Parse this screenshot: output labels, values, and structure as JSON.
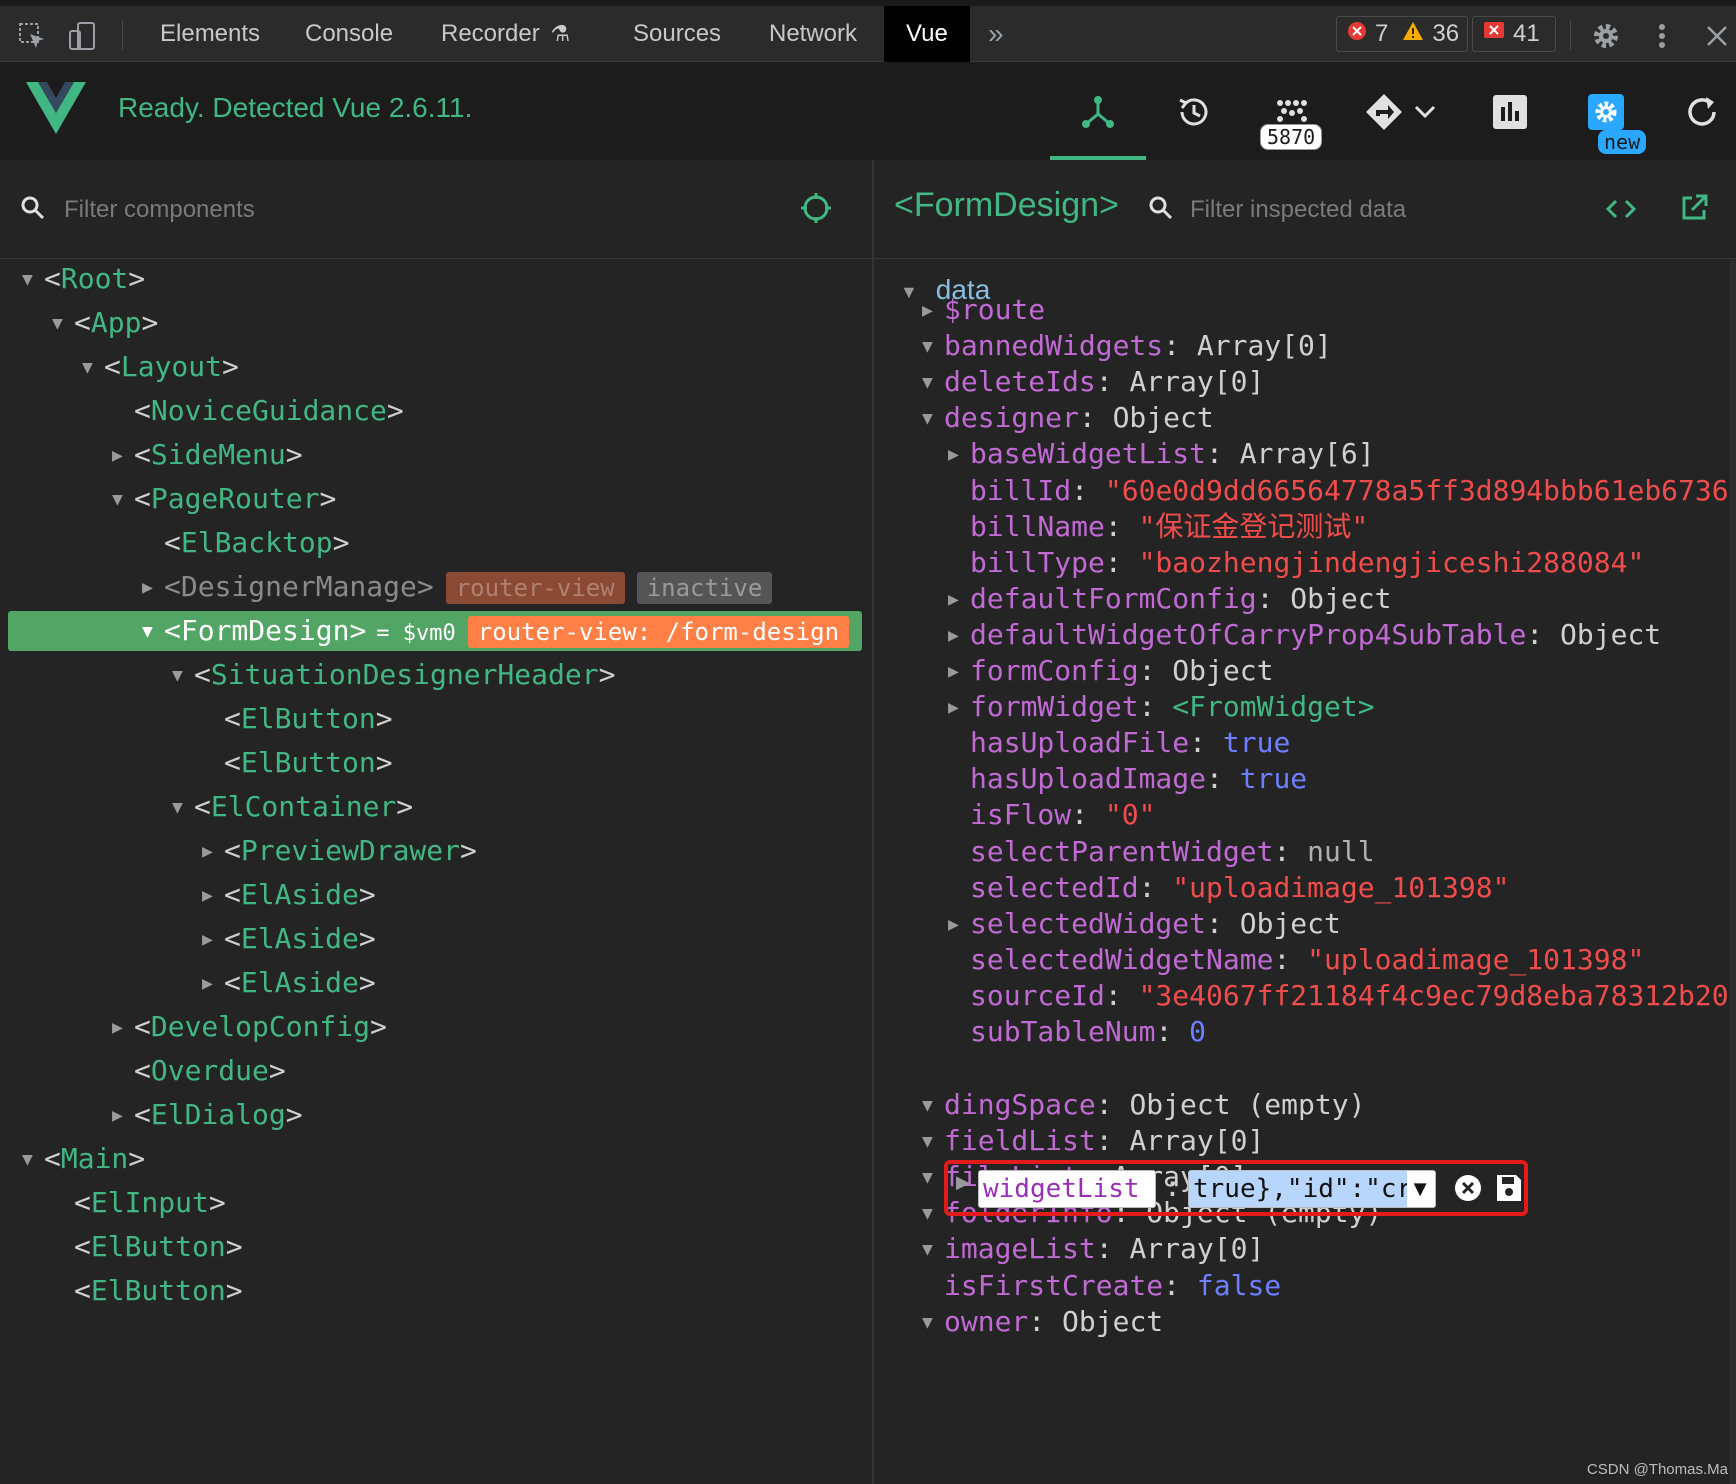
{
  "devtools": {
    "tabs": [
      "Elements",
      "Console",
      "Recorder",
      "Sources",
      "Network",
      "Vue"
    ],
    "active_tab": "Vue",
    "more": "»",
    "errors": "7",
    "warnings": "36",
    "issues": "41"
  },
  "vue": {
    "status": "Ready. Detected Vue 2.6.11.",
    "performance_count": "5870",
    "settings_badge": "new"
  },
  "components": {
    "filter_placeholder": "Filter components",
    "tree": [
      {
        "indent": 0,
        "arrow": "down",
        "name": "Root"
      },
      {
        "indent": 1,
        "arrow": "down",
        "name": "App"
      },
      {
        "indent": 2,
        "arrow": "down",
        "name": "Layout"
      },
      {
        "indent": 3,
        "arrow": "none",
        "name": "NoviceGuidance"
      },
      {
        "indent": 3,
        "arrow": "right",
        "name": "SideMenu"
      },
      {
        "indent": 3,
        "arrow": "down",
        "name": "PageRouter"
      },
      {
        "indent": 4,
        "arrow": "none",
        "name": "ElBacktop"
      },
      {
        "indent": 4,
        "arrow": "right",
        "name": "DesignerManage",
        "inactive": true,
        "badges": [
          "router-view",
          "inactive"
        ]
      },
      {
        "indent": 4,
        "arrow": "down",
        "name": "FormDesign",
        "selected": true,
        "suffix": "= $vm0",
        "badges": [
          "router-view: /form-design"
        ]
      },
      {
        "indent": 5,
        "arrow": "down",
        "name": "SituationDesignerHeader"
      },
      {
        "indent": 6,
        "arrow": "none",
        "name": "ElButton"
      },
      {
        "indent": 6,
        "arrow": "none",
        "name": "ElButton"
      },
      {
        "indent": 5,
        "arrow": "down",
        "name": "ElContainer"
      },
      {
        "indent": 6,
        "arrow": "right",
        "name": "PreviewDrawer"
      },
      {
        "indent": 6,
        "arrow": "right",
        "name": "ElAside"
      },
      {
        "indent": 6,
        "arrow": "right",
        "name": "ElAside"
      },
      {
        "indent": 6,
        "arrow": "right",
        "name": "ElAside"
      },
      {
        "indent": 3,
        "arrow": "right",
        "name": "DevelopConfig"
      },
      {
        "indent": 3,
        "arrow": "none",
        "name": "Overdue"
      },
      {
        "indent": 3,
        "arrow": "right",
        "name": "ElDialog"
      },
      {
        "indent": 0,
        "arrow": "down",
        "name": "Main"
      },
      {
        "indent": 1,
        "arrow": "none",
        "name": "ElInput"
      },
      {
        "indent": 1,
        "arrow": "none",
        "name": "ElButton"
      },
      {
        "indent": 1,
        "arrow": "none",
        "name": "ElButton"
      }
    ]
  },
  "inspector": {
    "title": "<FormDesign>",
    "filter_placeholder": "Filter inspected data",
    "section": "data",
    "props": [
      {
        "indent": 0,
        "arrow": "right",
        "key": "$route",
        "value": "",
        "type": "obj"
      },
      {
        "indent": 0,
        "arrow": "down",
        "key": "bannedWidgets",
        "value": "Array[0]",
        "type": "obj"
      },
      {
        "indent": 0,
        "arrow": "down",
        "key": "deleteIds",
        "value": "Array[0]",
        "type": "obj"
      },
      {
        "indent": 0,
        "arrow": "down",
        "key": "designer",
        "value": "Object",
        "type": "obj"
      },
      {
        "indent": 1,
        "arrow": "right",
        "key": "baseWidgetList",
        "value": "Array[6]",
        "type": "obj"
      },
      {
        "indent": 1,
        "arrow": "none",
        "key": "billId",
        "value": "\"60e0d9dd66564778a5ff3d894bbb61eb6736",
        "type": "str"
      },
      {
        "indent": 1,
        "arrow": "none",
        "key": "billName",
        "value": "\"保证金登记测试\"",
        "type": "str"
      },
      {
        "indent": 1,
        "arrow": "none",
        "key": "billType",
        "value": "\"baozhengjindengjiceshi288084\"",
        "type": "str"
      },
      {
        "indent": 1,
        "arrow": "right",
        "key": "defaultFormConfig",
        "value": "Object",
        "type": "obj"
      },
      {
        "indent": 1,
        "arrow": "right",
        "key": "defaultWidgetOfCarryProp4SubTable",
        "value": "Object",
        "type": "obj"
      },
      {
        "indent": 1,
        "arrow": "right",
        "key": "formConfig",
        "value": "Object",
        "type": "obj"
      },
      {
        "indent": 1,
        "arrow": "right",
        "key": "formWidget",
        "value": "<FromWidget>",
        "type": "comp"
      },
      {
        "indent": 1,
        "arrow": "none",
        "key": "hasUploadFile",
        "value": "true",
        "type": "bool"
      },
      {
        "indent": 1,
        "arrow": "none",
        "key": "hasUploadImage",
        "value": "true",
        "type": "bool"
      },
      {
        "indent": 1,
        "arrow": "none",
        "key": "isFlow",
        "value": "\"0\"",
        "type": "str"
      },
      {
        "indent": 1,
        "arrow": "none",
        "key": "selectParentWidget",
        "value": "null",
        "type": "null"
      },
      {
        "indent": 1,
        "arrow": "none",
        "key": "selectedId",
        "value": "\"uploadimage_101398\"",
        "type": "str"
      },
      {
        "indent": 1,
        "arrow": "right",
        "key": "selectedWidget",
        "value": "Object",
        "type": "obj"
      },
      {
        "indent": 1,
        "arrow": "none",
        "key": "selectedWidgetName",
        "value": "\"uploadimage_101398\"",
        "type": "str"
      },
      {
        "indent": 1,
        "arrow": "none",
        "key": "sourceId",
        "value": "\"3e4067ff21184f4c9ec79d8eba78312b20",
        "type": "str"
      },
      {
        "indent": 1,
        "arrow": "none",
        "key": "subTableNum",
        "value": "0",
        "type": "bool"
      }
    ],
    "edit_row": {
      "key": "widgetList",
      "value": "true},\"id\":\"createT",
      "dropdown": "▼"
    },
    "props_after": [
      {
        "indent": 0,
        "arrow": "down",
        "key": "dingSpace",
        "value": "Object (empty)",
        "type": "obj"
      },
      {
        "indent": 0,
        "arrow": "down",
        "key": "fieldList",
        "value": "Array[0]",
        "type": "obj"
      },
      {
        "indent": 0,
        "arrow": "down",
        "key": "fileList",
        "value": "Array[0]",
        "type": "obj"
      },
      {
        "indent": 0,
        "arrow": "down",
        "key": "folderInfo",
        "value": "Object (empty)",
        "type": "obj"
      },
      {
        "indent": 0,
        "arrow": "down",
        "key": "imageList",
        "value": "Array[0]",
        "type": "obj"
      },
      {
        "indent": 0,
        "arrow": "none",
        "key": "isFirstCreate",
        "value": "false",
        "type": "bool"
      },
      {
        "indent": 0,
        "arrow": "down",
        "key": "owner",
        "value": "Object",
        "type": "obj"
      }
    ]
  },
  "watermark": "CSDN @Thomas.Ma",
  "colors": {
    "vue_green": "#41b883",
    "selected_bg": "#53a565",
    "router_badge": "#ff8046",
    "error_red": "#e53935"
  }
}
